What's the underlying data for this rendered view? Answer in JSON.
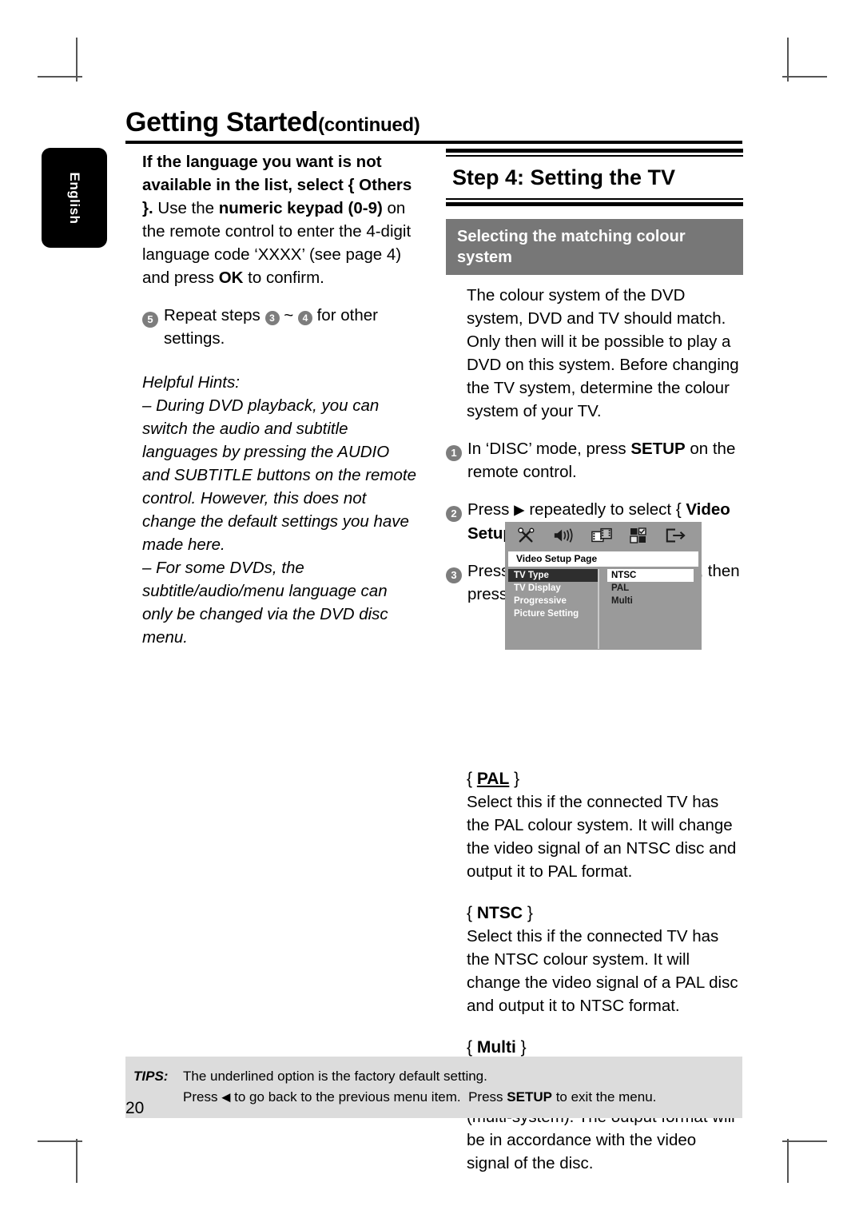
{
  "page": {
    "title_main": "Getting Started",
    "title_continued": "(continued)",
    "language_tab": "English",
    "page_number": "20"
  },
  "left_column": {
    "paragraph_html_parts": {
      "line1_bold": "If the language you want is not",
      "line2_bold": "available in the list, select { Others }.",
      "rest": "Use the numeric keypad (0-9) on the remote control to enter the 4-digit language code ‘XXXX’ (see page 4) and press OK to confirm."
    },
    "step5": {
      "number": "5",
      "text_before": "Repeat steps",
      "ref_a": "3",
      "tilde": "~",
      "ref_b": "4",
      "text_after": "for other settings."
    },
    "hints": {
      "heading": "Helpful Hints:",
      "items": [
        "– During DVD playback, you can switch the audio and subtitle languages by pressing the AUDIO and SUBTITLE buttons on the remote control.  However, this does not change the default settings you have made here.",
        "– For some DVDs, the subtitle/audio/menu language can only be changed via the DVD disc menu."
      ]
    }
  },
  "right_column": {
    "step4_title": "Step 4:  Setting the TV",
    "grey_heading": "Selecting the matching colour system",
    "intro": "The colour system of the DVD system, DVD and TV should match. Only then will it be possible to play a DVD on this system.  Before changing the TV system, determine the colour system of your TV.",
    "steps": [
      {
        "number": "1",
        "text": "In ‘DISC’ mode, press SETUP on the remote control."
      },
      {
        "number": "2",
        "text": "Press ▶ repeatedly to select { Video Setup Page }."
      },
      {
        "number": "3",
        "text": "Press ▼ to highlight { TV Type }, then press ▶."
      }
    ],
    "options": [
      {
        "label": "PAL",
        "underlined": true,
        "body": "Select this if the connected TV has the PAL colour system. It will change the video signal of an NTSC disc and output it to PAL format."
      },
      {
        "label": "NTSC",
        "underlined": false,
        "body": "Select this if the connected TV has the NTSC colour system. It will change the video signal of a PAL disc and output it to NTSC format."
      },
      {
        "label": "Multi",
        "underlined": false,
        "body": "Select this if the connected TV is compatible with both NTSC and PAL (multi-system).  The output format will be in accordance with the video signal of the disc."
      }
    ]
  },
  "dvd_menu": {
    "icons": [
      "tools-icon",
      "speaker-icon",
      "film-strip-icon",
      "checkered-squares-icon",
      "exit-arrow-icon"
    ],
    "title": "Video Setup Page",
    "menu_items": [
      "TV Type",
      "TV Display",
      "Progressive",
      "Picture Setting"
    ],
    "selected_menu_item": "TV Type",
    "options": [
      "NTSC",
      "PAL",
      "Multi"
    ],
    "selected_option": "NTSC"
  },
  "tips": {
    "label": "TIPS:",
    "line1": "The underlined option is the factory default setting.",
    "line2": "Press ◀ to go back to the previous menu item.  Press SETUP to exit the menu."
  },
  "colors": {
    "grey_heading_bg": "#777777",
    "tips_bg": "#dcdcdc",
    "dvd_bg": "#9a9a9a",
    "dvd_selected": "#2e2e2e",
    "bullet": "#7d7d7d"
  }
}
